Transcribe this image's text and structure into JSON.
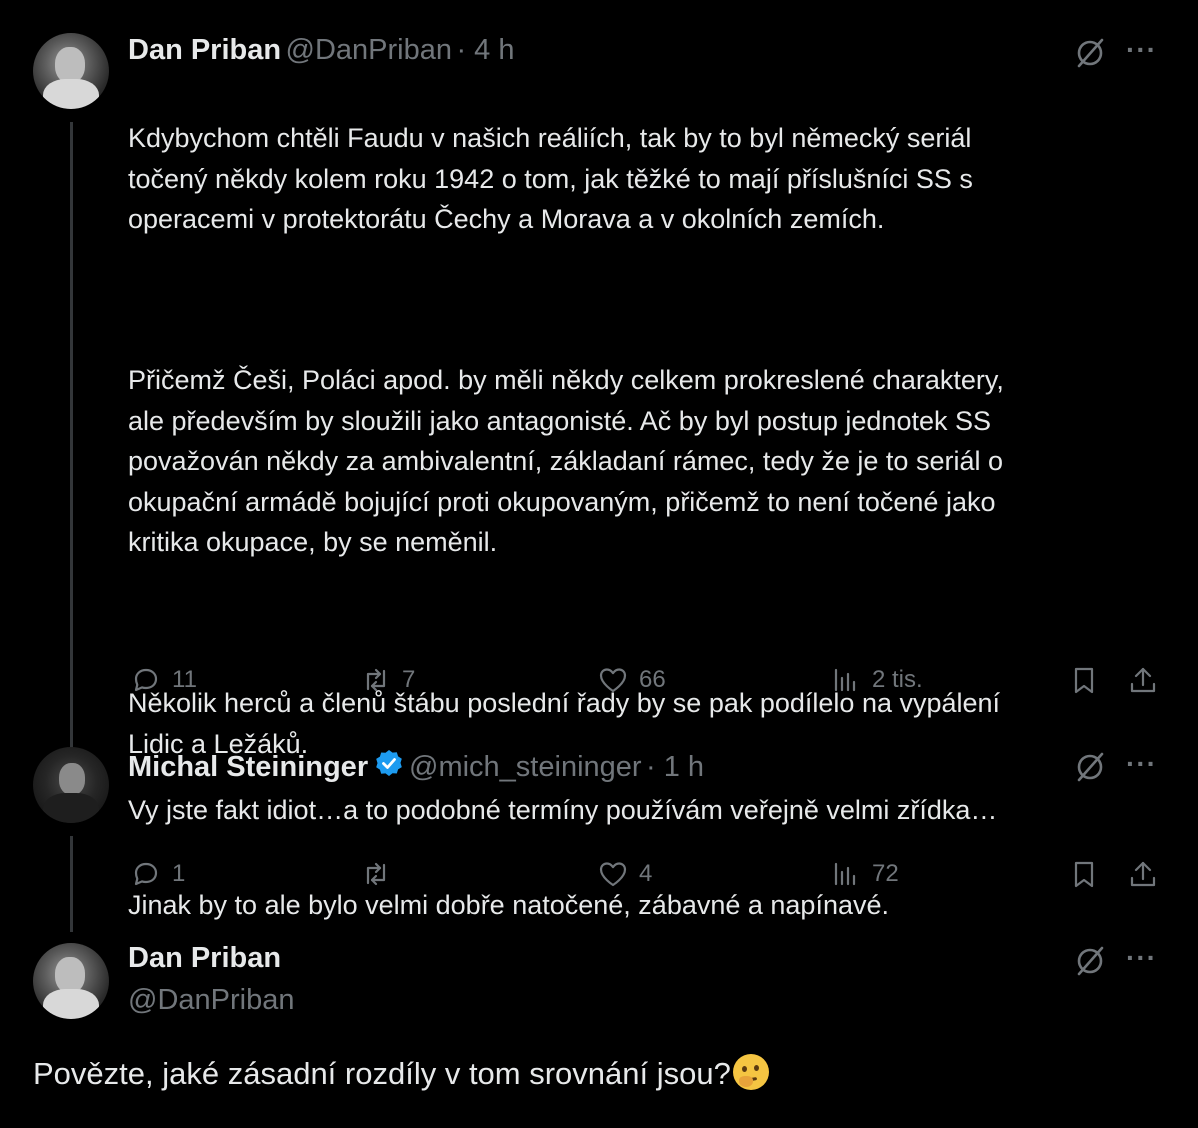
{
  "tweet1": {
    "name": "Dan Priban",
    "handle": "@DanPriban",
    "time": "· 4 h",
    "paragraphs": [
      "Kdybychom chtěli Faudu v našich reáliích, tak by to byl německý seriál\ntočený někdy kolem roku 1942 o tom, jak těžké to mají příslušníci SS s\noperacemi v protektorátu Čechy a Morava a v okolních zemích.",
      "Přičemž Češi, Poláci apod. by měli někdy celkem prokreslené charaktery,\nale především by sloužili jako antagonisté. Ač by byl postup jednotek SS\npovažován někdy za ambivalentní, základaní rámec, tedy že je to seriál o\nokupační armádě bojující proti okupovaným, přičemž to není točené jako\nkritika okupace, by se neměnil.",
      "Několik herců a členů štábu poslední řady by se pak podílelo na vypálení\nLidic a Ležáků.",
      "Jinak by to ale bylo velmi dobře natočené, zábavné a napínavé."
    ],
    "replies": "11",
    "retweets": "7",
    "likes": "66",
    "views": "2 tis.",
    "avatar_icon": "user-avatar-icon"
  },
  "tweet2": {
    "name": "Michal Steininger",
    "handle": "@mich_steininger",
    "time": "· 1 h",
    "text": "Vy jste fakt idiot…a to podobné termíny používám veřejně velmi zřídka…",
    "replies": "1",
    "retweets": "",
    "likes": "4",
    "views": "72",
    "verified_color": "#1d9bf0"
  },
  "tweet3": {
    "name": "Dan Priban",
    "handle": "@DanPriban",
    "text": "Povězte, jaké zásadní rozdíly v tom srovnání jsou?",
    "emoji": "🤔"
  },
  "more_label": "···"
}
